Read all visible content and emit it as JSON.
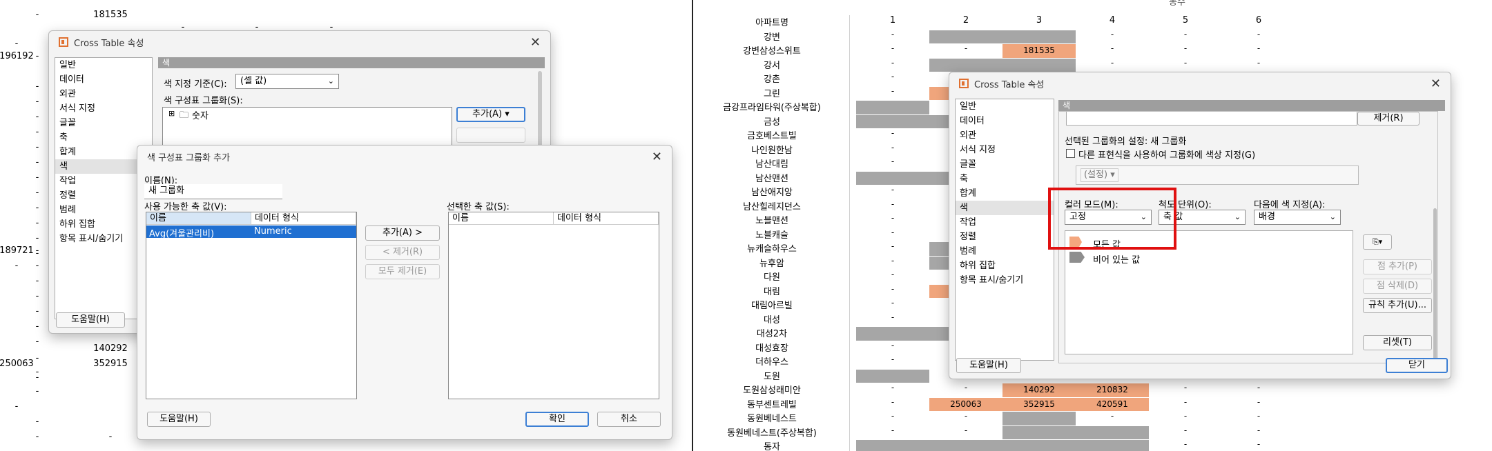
{
  "left_sheet": {
    "cells": [
      "-",
      "181535",
      "-",
      "-",
      "-",
      "-",
      "-",
      "196192",
      "-",
      "-",
      "-",
      "-",
      "-",
      "-",
      "-",
      "-",
      "-",
      "-",
      "-",
      "-",
      "-",
      "-",
      "189721",
      "-",
      "-",
      "-",
      "-",
      "-",
      "-",
      "-",
      "-",
      "140292",
      "250063",
      "352915",
      "-",
      "-",
      "-",
      "-",
      "-",
      "-",
      "-"
    ]
  },
  "left_dialog": {
    "title": "Cross Table 속성",
    "nav": [
      "일반",
      "데이터",
      "외관",
      "서식 지정",
      "글꼴",
      "축",
      "합계",
      "색",
      "작업",
      "정렬",
      "범례",
      "하위 집합",
      "항목 표시/숨기기"
    ],
    "section": "색",
    "color_basis_label": "색 지정 기준(C):",
    "color_basis_value": "(셀 값)",
    "grouping_label": "색 구성표 그룹화(S):",
    "tree_item": "숫자",
    "add_btn": "추가(A)",
    "help_btn": "도움말(H)"
  },
  "add_dialog": {
    "title": "색 구성표 그룹화 추가",
    "name_label": "이름(N):",
    "name_value": "새 그룹화",
    "available_label": "사용 가능한 축 값(V):",
    "selected_label": "선택한 축 값(S):",
    "col_name": "이름",
    "col_type": "데이터 형식",
    "row_name": "Avg(겨울관리비)",
    "row_type": "Numeric",
    "add_btn": "추가(A) >",
    "remove_btn": "< 제거(R)",
    "remove_all_btn": "모두 제거(E)",
    "help_btn": "도움말(H)",
    "ok_btn": "확인",
    "cancel_btn": "취소"
  },
  "right_sheet": {
    "top_header": "동수",
    "row_header": "아파트명",
    "columns": [
      "1",
      "2",
      "3",
      "4",
      "5",
      "6"
    ],
    "rows": [
      "강변",
      "강변삼성스위트",
      "강서",
      "강촌",
      "그린",
      "금강프라임타워(주상복합)",
      "금성",
      "금호베스트빌",
      "나인원한남",
      "남산대림",
      "남산맨션",
      "남산애지앙",
      "남산힐레지던스",
      "노블맨션",
      "노블캐슬",
      "뉴캐슬하우스",
      "뉴후암",
      "다원",
      "대림",
      "대림아르빌",
      "대성",
      "대성2차",
      "대성효장",
      "더하우스",
      "도원",
      "도원삼성래미안",
      "동부센트레빌",
      "동원베네스트",
      "동원베네스트(주상복합)",
      "동자"
    ],
    "v_181535": "181535",
    "v_196192": "196192",
    "v_189721": "189721",
    "v_140292": "140292",
    "v_210832": "210832",
    "v_250063": "250063",
    "v_352915": "352915",
    "v_420591": "420591",
    "dash": "-"
  },
  "right_dialog": {
    "title": "Cross Table 속성",
    "nav": [
      "일반",
      "데이터",
      "외관",
      "서식 지정",
      "글꼴",
      "축",
      "합계",
      "색",
      "작업",
      "정렬",
      "범례",
      "하위 집합",
      "항목 표시/숨기기"
    ],
    "section": "색",
    "remove_btn": "제거(R)",
    "group_setting": "선택된 그룹화의 설정: 새 그룹화",
    "checkbox_label": "다른 표현식을 사용하여 그룹화에 색상 지정(G)",
    "setting_placeholder": "(설정)",
    "color_mode_label": "컬러 모드(M):",
    "color_mode_value": "고정",
    "scale_label": "척도 단위(O):",
    "scale_value": "축 값",
    "apply_label": "다음에 색 지정(A):",
    "apply_value": "배경",
    "all_values": "모든 값",
    "empty_values": "비어 있는 값",
    "add_point": "점 추가(P)",
    "delete_point": "점 삭제(D)",
    "add_rule": "규칙 추가(U)...",
    "reset": "리셋(T)",
    "help_btn": "도움말(H)",
    "close_btn": "닫기"
  }
}
